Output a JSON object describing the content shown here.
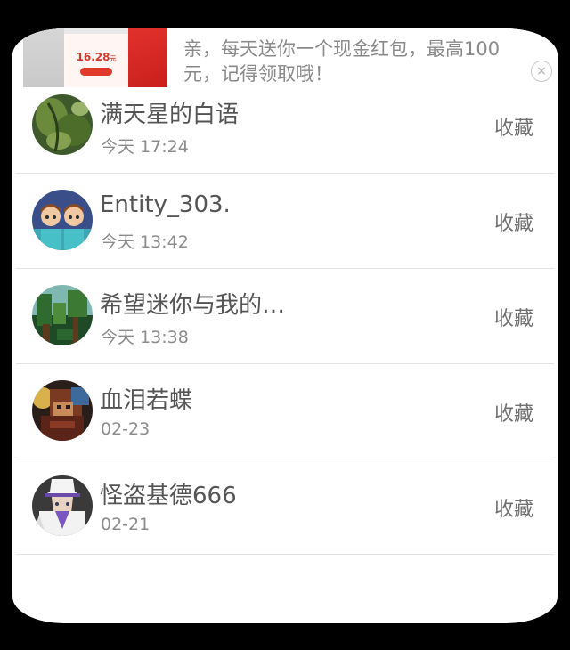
{
  "ad": {
    "text_line1": "亲，每天送你一个现金红包，最高100",
    "text_line2": "元，记得领取哦！",
    "thumb_amount": "16.28",
    "thumb_unit": "元",
    "close_glyph": "×"
  },
  "items": [
    {
      "name": "满天星的白语",
      "time": "今天 17:24",
      "action": "收藏",
      "avatar_icon": "leaf-avatar"
    },
    {
      "name": "Entity_303.",
      "time": "今天 13:42",
      "action": "收藏",
      "avatar_icon": "twins-avatar"
    },
    {
      "name": "希望迷你与我的…",
      "time": "今天 13:38",
      "action": "收藏",
      "avatar_icon": "jungle-avatar"
    },
    {
      "name": "血泪若蝶",
      "time": "02-23",
      "action": "收藏",
      "avatar_icon": "character-avatar"
    },
    {
      "name": "怪盗基德666",
      "time": "02-21",
      "action": "收藏",
      "avatar_icon": "kaito-kid-avatar"
    }
  ],
  "colors": {
    "background": "#000000",
    "panel": "#ffffff",
    "name_text": "#555555",
    "time_text": "#8c8c8c",
    "action_text": "#707070",
    "divider": "#e3e3e3"
  }
}
